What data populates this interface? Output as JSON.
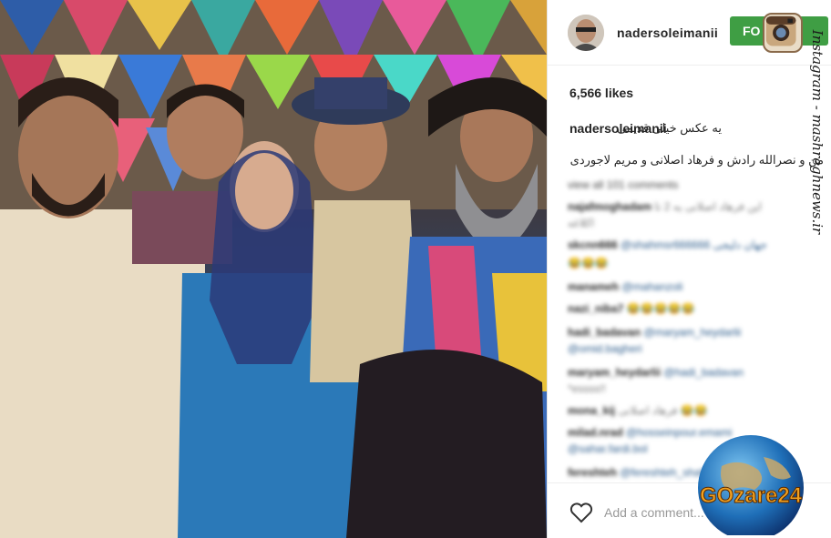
{
  "post": {
    "username": "nadersoleimanii",
    "follow_label": "FO",
    "likes": "6,566 likes",
    "caption_user": "nadersoleimanii",
    "caption_line1": "یه عکس خیلی قدیمی",
    "caption_line2": "من و نصرالله رادش و فرهاد اصلانی و مریم لاجوردی",
    "view_all": "view all 101 comments",
    "add_comment_placeholder": "Add a comment..."
  },
  "comments": [
    {
      "user": "najafmoghadam",
      "text": "این فرهاد اصلانی یه 2 تا"
    },
    {
      "user": "",
      "text": "اکلاغه"
    },
    {
      "user": "skcnn666",
      "text": "@shahmsr666666 جهان دلیجی"
    },
    {
      "user": "",
      "text": "😂😂😂"
    },
    {
      "user": "manameh",
      "text": "@mahanzoli"
    },
    {
      "user": "nazi_niba7",
      "text": "😂😂😂😂😂"
    },
    {
      "user": "hadi_badavan",
      "text": "@maryam_heydarlii"
    },
    {
      "user": "",
      "text": "@omid.bagheri"
    },
    {
      "user": "maryam_heydarlii",
      "text": "@hadi_badavan"
    },
    {
      "user": "",
      "text": "*essss!!"
    },
    {
      "user": "mona_kij",
      "text": "فرهاد اصلانی 😂😂"
    },
    {
      "user": "milad.nrad",
      "text": "@hosseinpour.emami"
    },
    {
      "user": "",
      "text": "@sahar.fardi.bol"
    },
    {
      "user": "fereshteh",
      "text": "@fereshteh_shafaei"
    }
  ],
  "watermarks": {
    "instagram_side": "Instagram - mashreghnews.ir",
    "gozare": "GOzare24"
  },
  "colors": {
    "follow_green": "#3f9e44",
    "text_dark": "#262626",
    "link_blue": "#2a5a8a"
  },
  "icons": {
    "heart": "heart-icon",
    "instagram_logo": "instagram-logo",
    "avatar": "user-avatar"
  }
}
